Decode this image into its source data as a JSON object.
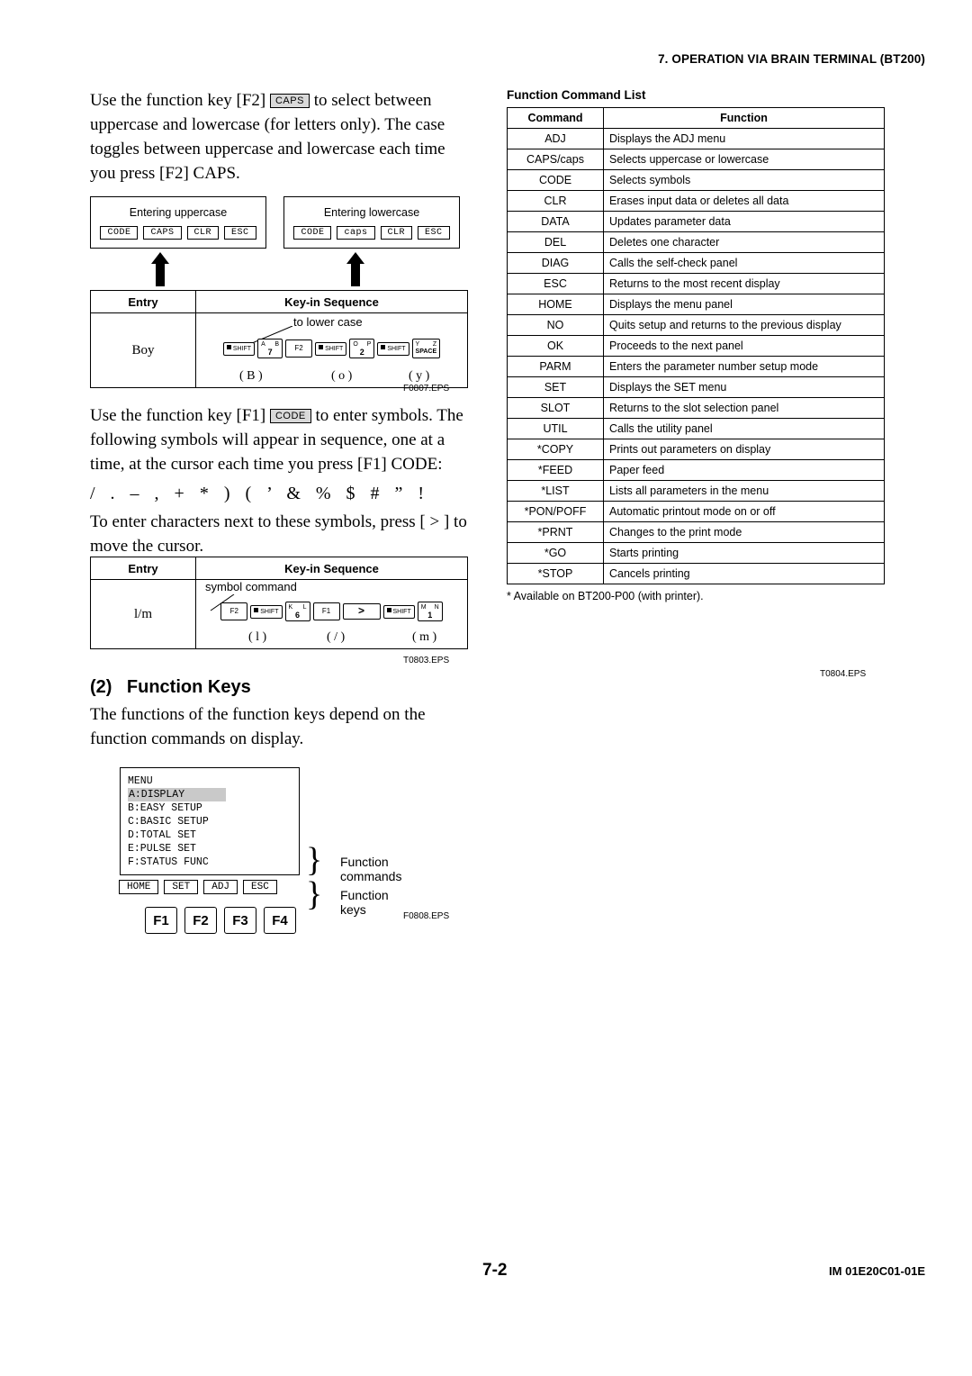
{
  "header": {
    "title": "7.  OPERATION VIA BRAIN TERMINAL (BT200)"
  },
  "left": {
    "para1_a": "Use the function key [F2] ",
    "para1_key": "CAPS",
    "para1_b": " to select between uppercase and lowercase (for letters only). The case toggles between uppercase and lowercase each time you press [F2] CAPS.",
    "fig_caps": {
      "left_box": {
        "title": "Entering uppercase",
        "keys": [
          "CODE",
          "CAPS",
          "CLR",
          "ESC"
        ]
      },
      "right_box": {
        "title": "Entering lowercase",
        "keys": [
          "CODE",
          "caps",
          "CLR",
          "ESC"
        ]
      },
      "table_head": {
        "entry": "Entry",
        "sequence": "Key-in Sequence"
      },
      "note": "to lower case",
      "entry_value": "Boy",
      "keys": [
        {
          "type": "shift",
          "label": "SHIFT"
        },
        {
          "type": "char",
          "top_left": "A",
          "top_right": "B",
          "bottom": "7"
        },
        {
          "type": "plain",
          "label": "F2"
        },
        {
          "type": "shift",
          "label": "SHIFT"
        },
        {
          "type": "char",
          "top_left": "O",
          "top_right": "P",
          "bottom": "2"
        },
        {
          "type": "shift",
          "label": "SHIFT"
        },
        {
          "type": "char",
          "top_left": "Y",
          "top_right": "Z",
          "bottom": "SPACE"
        }
      ],
      "letters": [
        "( B )",
        "( o )",
        "( y )"
      ],
      "eps": "F0807.EPS"
    },
    "para2_a": "Use the function key [F1] ",
    "para2_key": "CODE",
    "para2_b": " to enter symbols. The following symbols will appear in sequence, one at a time, at the cursor each time you press [F1] CODE:",
    "symbols": "/  .  –  ,  +  *  )  (  ’  &  %  $  #  ”  !",
    "para3": "To enter characters next to these symbols, press [ > ] to move the cursor.",
    "fig_symbol": {
      "table_head": {
        "entry": "Entry",
        "sequence": "Key-in Sequence"
      },
      "note": "symbol command",
      "entry_value": "l/m",
      "keys": [
        {
          "type": "plain",
          "label": "F2"
        },
        {
          "type": "shift",
          "label": "SHIFT"
        },
        {
          "type": "char",
          "top_left": "K",
          "top_right": "L",
          "bottom": "6"
        },
        {
          "type": "plain",
          "label": "F1"
        },
        {
          "type": "arrow",
          "label": ">"
        },
        {
          "type": "shift",
          "label": "SHIFT"
        },
        {
          "type": "char",
          "top_left": "M",
          "top_right": "N",
          "bottom": "1"
        }
      ],
      "letters": [
        "( l )",
        "( / )",
        "( m )"
      ],
      "eps": "T0803.EPS"
    },
    "section": {
      "number": "(2)",
      "title": "Function Keys"
    },
    "para4": "The functions of the function keys depend on the function commands on display.",
    "fig_menu": {
      "menu_title": "MENU",
      "menu_items": [
        "A:DISPLAY",
        "B:EASY SETUP",
        "C:BASIC SETUP",
        "D:TOTAL SET",
        "E:PULSE SET",
        "F:STATUS FUNC"
      ],
      "highlight_item_index": 0,
      "commands": [
        "HOME",
        "SET",
        "ADJ",
        "ESC"
      ],
      "fkeys": [
        "F1",
        "F2",
        "F3",
        "F4"
      ],
      "label_commands": "Function commands",
      "label_keys": "Function keys",
      "eps": "F0808.EPS"
    }
  },
  "right": {
    "title": "Function Command List",
    "columns": [
      "Command",
      "Function"
    ],
    "rows": [
      [
        "ADJ",
        "Displays the ADJ menu"
      ],
      [
        "CAPS/caps",
        "Selects uppercase or lowercase"
      ],
      [
        "CODE",
        "Selects symbols"
      ],
      [
        "CLR",
        "Erases input data or deletes all data"
      ],
      [
        "DATA",
        "Updates parameter data"
      ],
      [
        "DEL",
        "Deletes one character"
      ],
      [
        "DIAG",
        "Calls the self-check panel"
      ],
      [
        "ESC",
        "Returns to the most recent display"
      ],
      [
        "HOME",
        "Displays the menu panel"
      ],
      [
        "NO",
        "Quits setup and returns to the previous display"
      ],
      [
        "OK",
        "Proceeds to the next panel"
      ],
      [
        "PARM",
        "Enters the parameter number setup mode"
      ],
      [
        "SET",
        "Displays the SET menu"
      ],
      [
        "SLOT",
        "Returns to the slot selection panel"
      ],
      [
        "UTIL",
        "Calls the utility panel"
      ],
      [
        "*COPY",
        "Prints out parameters on display"
      ],
      [
        "*FEED",
        "Paper feed"
      ],
      [
        "*LIST",
        "Lists all parameters in the menu"
      ],
      [
        "*PON/POFF",
        "Automatic printout mode on or off"
      ],
      [
        "*PRNT",
        "Changes to the print  mode"
      ],
      [
        "*GO",
        "Starts printing"
      ],
      [
        "*STOP",
        "Cancels printing"
      ]
    ],
    "footnote": "* Available on BT200-P00 (with printer).",
    "eps": "T0804.EPS"
  },
  "footer": {
    "page": "7-2",
    "doc_id": "IM 01E20C01-01E"
  }
}
